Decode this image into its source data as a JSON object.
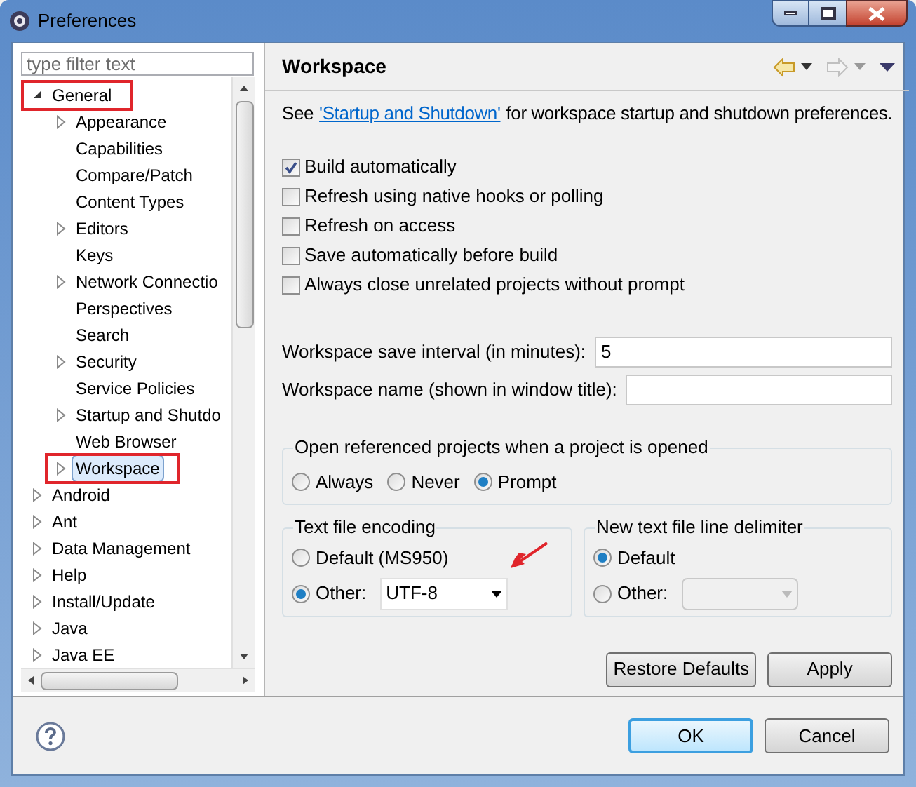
{
  "window": {
    "title": "Preferences"
  },
  "filter": {
    "placeholder": "type filter text"
  },
  "tree": [
    {
      "label": "General",
      "expanded": true,
      "selected": false,
      "highlighted": true,
      "children": [
        {
          "label": "Appearance",
          "expanded": false,
          "selected": false,
          "highlighted": false
        },
        {
          "label": "Capabilities",
          "selected": false,
          "highlighted": false
        },
        {
          "label": "Compare/Patch",
          "selected": false,
          "highlighted": false
        },
        {
          "label": "Content Types",
          "selected": false,
          "highlighted": false
        },
        {
          "label": "Editors",
          "expanded": false,
          "selected": false,
          "highlighted": false
        },
        {
          "label": "Keys",
          "selected": false,
          "highlighted": false
        },
        {
          "label": "Network Connectio",
          "expanded": false,
          "selected": false,
          "highlighted": false
        },
        {
          "label": "Perspectives",
          "selected": false,
          "highlighted": false
        },
        {
          "label": "Search",
          "selected": false,
          "highlighted": false
        },
        {
          "label": "Security",
          "expanded": false,
          "selected": false,
          "highlighted": false
        },
        {
          "label": "Service Policies",
          "selected": false,
          "highlighted": false
        },
        {
          "label": "Startup and Shutdo",
          "expanded": false,
          "selected": false,
          "highlighted": false
        },
        {
          "label": "Web Browser",
          "selected": false,
          "highlighted": false
        },
        {
          "label": "Workspace",
          "expanded": false,
          "selected": true,
          "highlighted": true
        }
      ]
    },
    {
      "label": "Android",
      "expanded": false,
      "selected": false,
      "highlighted": false
    },
    {
      "label": "Ant",
      "expanded": false,
      "selected": false,
      "highlighted": false
    },
    {
      "label": "Data Management",
      "expanded": false,
      "selected": false,
      "highlighted": false
    },
    {
      "label": "Help",
      "expanded": false,
      "selected": false,
      "highlighted": false
    },
    {
      "label": "Install/Update",
      "expanded": false,
      "selected": false,
      "highlighted": false
    },
    {
      "label": "Java",
      "expanded": false,
      "selected": false,
      "highlighted": false
    },
    {
      "label": "Java EE",
      "expanded": false,
      "selected": false,
      "highlighted": false
    }
  ],
  "page": {
    "title": "Workspace",
    "intro_before": "See",
    "intro_link": "'Startup and Shutdown'",
    "intro_after": "for workspace startup and shutdown preferences.",
    "checkboxes": [
      {
        "label": "Build automatically",
        "checked": true
      },
      {
        "label": "Refresh using native hooks or polling",
        "checked": false
      },
      {
        "label": "Refresh on access",
        "checked": false
      },
      {
        "label": "Save automatically before build",
        "checked": false
      },
      {
        "label": "Always close unrelated projects without prompt",
        "checked": false
      }
    ],
    "fields": [
      {
        "label": "Workspace save interval (in minutes):",
        "value": "5"
      },
      {
        "label": "Workspace name (shown in window title):"
      }
    ],
    "open_group": {
      "title": "Open referenced projects when a project is opened",
      "options": [
        {
          "label": "Always",
          "selected": false
        },
        {
          "label": "Never",
          "selected": false
        },
        {
          "label": "Prompt",
          "selected": true
        }
      ]
    },
    "encoding": {
      "title": "Text file encoding",
      "default_label": "Default (MS950)",
      "default_selected": false,
      "other_label": "Other:",
      "other_selected": true,
      "value": "UTF-8",
      "arrow": true
    },
    "delimiter": {
      "title": "New text file line delimiter",
      "default_label": "Default",
      "default_selected": true,
      "other_label": "Other:",
      "other_selected": false
    },
    "buttons": [
      "Restore Defaults",
      "Apply"
    ]
  },
  "footer": {
    "buttons": [
      "OK",
      "Cancel"
    ]
  }
}
